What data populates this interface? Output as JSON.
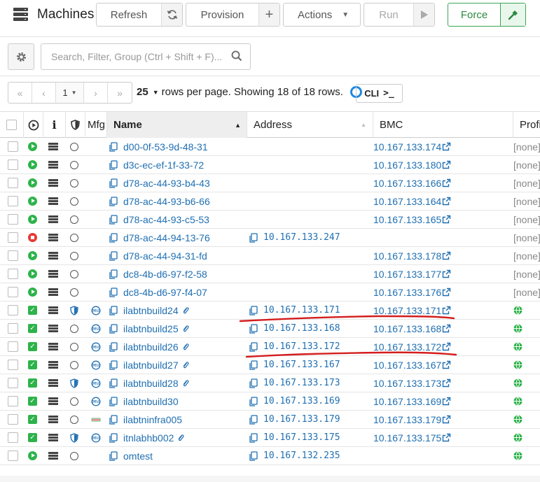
{
  "header": {
    "title": "Machines",
    "refresh_label": "Refresh",
    "provision_label": "Provision",
    "actions_label": "Actions",
    "run_label": "Run",
    "force_label": "Force"
  },
  "search": {
    "placeholder": "Search, Filter, Group (Ctrl + Shift + F)..."
  },
  "pagination": {
    "first": "«",
    "prev": "‹",
    "page": "1",
    "next": "›",
    "last": "»",
    "rows_per_page": "25",
    "rows_label": "rows per page. Showing 18 of 18 rows.",
    "cli_label": "CLI"
  },
  "columns": {
    "mfg": "Mfg",
    "name": "Name",
    "address": "Address",
    "bmc": "BMC",
    "profile": "Profi"
  },
  "colors": {
    "accent_blue": "#1f6fb2",
    "status_green": "#2db34a",
    "status_red": "#e53935",
    "annotation_red": "#d41d1d"
  },
  "rows": [
    {
      "status": "running",
      "shield": false,
      "mfg": "",
      "name": "d00-0f-53-9d-48-31",
      "linked": false,
      "address": "",
      "bmc": "10.167.133.174",
      "profile": "[none]"
    },
    {
      "status": "running",
      "shield": false,
      "mfg": "",
      "name": "d3c-ec-ef-1f-33-72",
      "linked": false,
      "address": "",
      "bmc": "10.167.133.180",
      "profile": "[none]"
    },
    {
      "status": "running",
      "shield": false,
      "mfg": "",
      "name": "d78-ac-44-93-b4-43",
      "linked": false,
      "address": "",
      "bmc": "10.167.133.166",
      "profile": "[none]"
    },
    {
      "status": "running",
      "shield": false,
      "mfg": "",
      "name": "d78-ac-44-93-b6-66",
      "linked": false,
      "address": "",
      "bmc": "10.167.133.164",
      "profile": "[none]"
    },
    {
      "status": "running",
      "shield": false,
      "mfg": "",
      "name": "d78-ac-44-93-c5-53",
      "linked": false,
      "address": "",
      "bmc": "10.167.133.165",
      "profile": "[none]"
    },
    {
      "status": "stopped",
      "shield": false,
      "mfg": "",
      "name": "d78-ac-44-94-13-76",
      "linked": false,
      "address": "10.167.133.247",
      "bmc": "",
      "profile": "[none]"
    },
    {
      "status": "running",
      "shield": false,
      "mfg": "",
      "name": "d78-ac-44-94-31-fd",
      "linked": false,
      "address": "",
      "bmc": "10.167.133.178",
      "profile": "[none]"
    },
    {
      "status": "running",
      "shield": false,
      "mfg": "",
      "name": "dc8-4b-d6-97-f2-58",
      "linked": false,
      "address": "",
      "bmc": "10.167.133.177",
      "profile": "[none]"
    },
    {
      "status": "running",
      "shield": false,
      "mfg": "",
      "name": "dc8-4b-d6-97-f4-07",
      "linked": false,
      "address": "",
      "bmc": "10.167.133.176",
      "profile": "[none]"
    },
    {
      "status": "ready",
      "shield": true,
      "mfg": "dell",
      "name": "ilabtnbuild24",
      "linked": true,
      "address": "10.167.133.171",
      "bmc": "10.167.133.171",
      "profile": "globe"
    },
    {
      "status": "ready",
      "shield": false,
      "mfg": "dell",
      "name": "ilabtnbuild25",
      "linked": true,
      "address": "10.167.133.168",
      "bmc": "10.167.133.168",
      "profile": "globe"
    },
    {
      "status": "ready",
      "shield": false,
      "mfg": "dell",
      "name": "ilabtnbuild26",
      "linked": true,
      "address": "10.167.133.172",
      "bmc": "10.167.133.172",
      "profile": "globe"
    },
    {
      "status": "ready",
      "shield": false,
      "mfg": "dell",
      "name": "ilabtnbuild27",
      "linked": true,
      "address": "10.167.133.167",
      "bmc": "10.167.133.167",
      "profile": "globe"
    },
    {
      "status": "ready",
      "shield": true,
      "mfg": "dell",
      "name": "ilabtnbuild28",
      "linked": true,
      "address": "10.167.133.173",
      "bmc": "10.167.133.173",
      "profile": "globe"
    },
    {
      "status": "ready",
      "shield": false,
      "mfg": "dell",
      "name": "ilabtnbuild30",
      "linked": false,
      "address": "10.167.133.169",
      "bmc": "10.167.133.169",
      "profile": "globe"
    },
    {
      "status": "ready",
      "shield": false,
      "mfg": "hp",
      "name": "ilabtninfra005",
      "linked": false,
      "address": "10.167.133.179",
      "bmc": "10.167.133.179",
      "profile": "globe"
    },
    {
      "status": "ready",
      "shield": true,
      "mfg": "dell",
      "name": "itnlabhb002",
      "linked": true,
      "address": "10.167.133.175",
      "bmc": "10.167.133.175",
      "profile": "globe"
    },
    {
      "status": "running",
      "shield": false,
      "mfg": "",
      "name": "omtest",
      "linked": false,
      "address": "10.167.132.235",
      "bmc": "",
      "profile": "globe"
    }
  ]
}
